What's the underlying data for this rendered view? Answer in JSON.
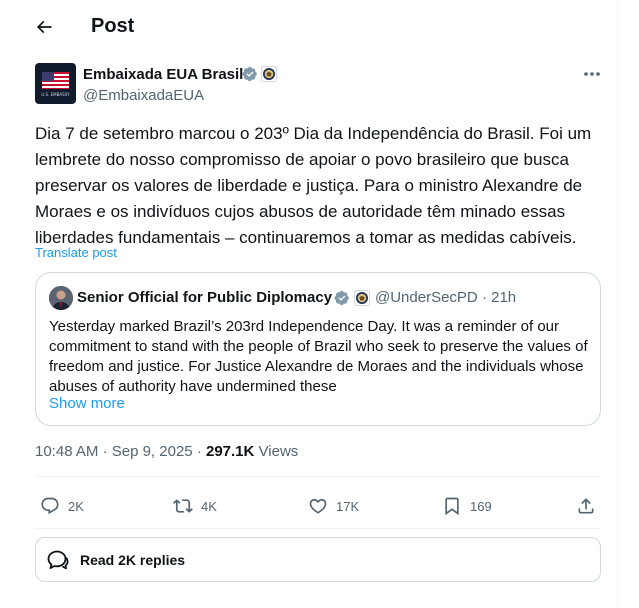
{
  "header": {
    "title": "Post",
    "back_icon": "arrow-left-icon"
  },
  "author": {
    "name": "Embaixada EUA Brasil",
    "handle": "@EmbaixadaEUA",
    "avatar_caption": "U.S. EMBASSY",
    "verified_icon": "verified-badge-icon",
    "affiliation_icon": "us-state-department-seal-icon"
  },
  "post": {
    "text": "Dia 7 de setembro marcou o 203º Dia da Independência do Brasil. Foi um lembrete do nosso compromisso de apoiar o povo brasileiro que busca preservar os valores de liberdade e justiça. Para o ministro Alexandre de Moraes e os indivíduos cujos abusos de autoridade têm minado essas liberdades fundamentais – continuaremos a tomar as medidas cabíveis.",
    "translate_label": "Translate post",
    "time": "10:48 AM",
    "separator": "·",
    "date": "Sep 9, 2025",
    "views_count": "297.1K",
    "views_label": "Views"
  },
  "quote": {
    "name": "Senior Official for Public Diplomacy",
    "handle": "@UnderSecPD",
    "separator": "·",
    "age": "21h",
    "text": "Yesterday marked Brazil’s 203rd Independence Day. It was a reminder of our commitment to stand with the people of Brazil who seek to preserve the values of freedom and justice. For Justice Alexandre de Moraes and the individuals whose abuses of authority have undermined these",
    "show_more": "Show more"
  },
  "actions": {
    "replies": "2K",
    "reposts": "4K",
    "likes": "17K",
    "bookmarks": "169"
  },
  "read_replies": {
    "label": "Read 2K replies"
  },
  "colors": {
    "accent": "#1d9bf0",
    "text": "#0f1419",
    "muted": "#536471",
    "border": "#cfd9de"
  }
}
